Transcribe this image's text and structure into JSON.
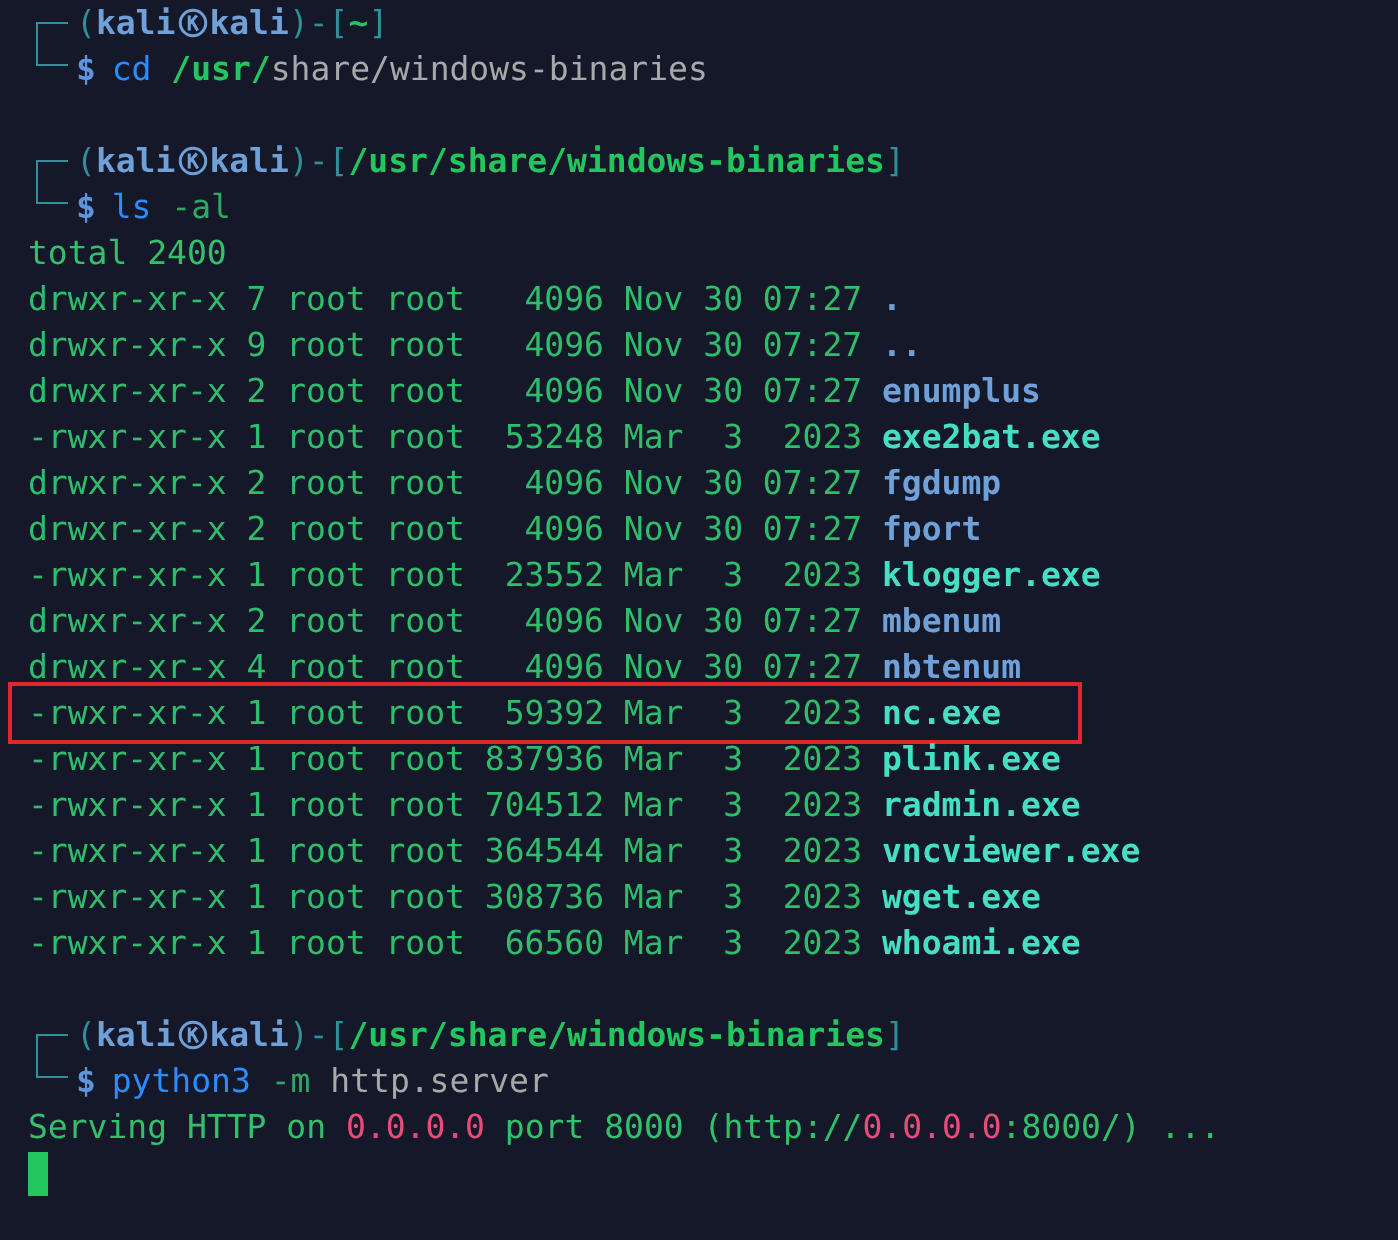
{
  "terminal": {
    "blocks": [
      {
        "kind": "prompt",
        "prompt": [
          {
            "kind": "frame",
            "text": "("
          },
          {
            "kind": "user",
            "text": "kali"
          },
          {
            "kind": "mark"
          },
          {
            "kind": "user",
            "text": "kali"
          },
          {
            "kind": "frame",
            "text": ")-["
          },
          {
            "kind": "path",
            "text": "~"
          },
          {
            "kind": "frame",
            "text": "]"
          }
        ],
        "command": [
          {
            "kind": "symbol",
            "text": "$"
          },
          {
            "kind": "program",
            "text": "cd"
          },
          {
            "kind": "path",
            "text": "/usr/"
          },
          {
            "kind": "argument",
            "text": "share/windows-binaries"
          }
        ]
      },
      {
        "kind": "blank"
      },
      {
        "kind": "prompt",
        "prompt": [
          {
            "kind": "frame",
            "text": "("
          },
          {
            "kind": "user",
            "text": "kali"
          },
          {
            "kind": "mark"
          },
          {
            "kind": "user",
            "text": "kali"
          },
          {
            "kind": "frame",
            "text": ")-["
          },
          {
            "kind": "path",
            "text": "/usr/share/windows-binaries"
          },
          {
            "kind": "frame",
            "text": "]"
          }
        ],
        "command": [
          {
            "kind": "symbol",
            "text": "$"
          },
          {
            "kind": "program",
            "text": "ls"
          },
          {
            "kind": "flag",
            "text": "-al"
          }
        ]
      },
      {
        "kind": "output",
        "segments": [
          {
            "kind": "plain",
            "text": "total 2400"
          }
        ]
      },
      {
        "kind": "entry",
        "mode": "drwxr-xr-x",
        "links": "7",
        "owner": "root",
        "group": "root",
        "size": "4096",
        "month": "Nov",
        "day": "30",
        "time": "07:27",
        "file": {
          "name": ".",
          "kind": "dir"
        },
        "highlighted": false
      },
      {
        "kind": "entry",
        "mode": "drwxr-xr-x",
        "links": "9",
        "owner": "root",
        "group": "root",
        "size": "4096",
        "month": "Nov",
        "day": "30",
        "time": "07:27",
        "file": {
          "name": "..",
          "kind": "dir"
        },
        "highlighted": false
      },
      {
        "kind": "entry",
        "mode": "drwxr-xr-x",
        "links": "2",
        "owner": "root",
        "group": "root",
        "size": "4096",
        "month": "Nov",
        "day": "30",
        "time": "07:27",
        "file": {
          "name": "enumplus",
          "kind": "dir"
        },
        "highlighted": false
      },
      {
        "kind": "entry",
        "mode": "-rwxr-xr-x",
        "links": "1",
        "owner": "root",
        "group": "root",
        "size": "53248",
        "month": "Mar",
        "day": "3",
        "time": "2023",
        "file": {
          "name": "exe2bat.exe",
          "kind": "exe"
        },
        "highlighted": false
      },
      {
        "kind": "entry",
        "mode": "drwxr-xr-x",
        "links": "2",
        "owner": "root",
        "group": "root",
        "size": "4096",
        "month": "Nov",
        "day": "30",
        "time": "07:27",
        "file": {
          "name": "fgdump",
          "kind": "dir"
        },
        "highlighted": false
      },
      {
        "kind": "entry",
        "mode": "drwxr-xr-x",
        "links": "2",
        "owner": "root",
        "group": "root",
        "size": "4096",
        "month": "Nov",
        "day": "30",
        "time": "07:27",
        "file": {
          "name": "fport",
          "kind": "dir"
        },
        "highlighted": false
      },
      {
        "kind": "entry",
        "mode": "-rwxr-xr-x",
        "links": "1",
        "owner": "root",
        "group": "root",
        "size": "23552",
        "month": "Mar",
        "day": "3",
        "time": "2023",
        "file": {
          "name": "klogger.exe",
          "kind": "exe"
        },
        "highlighted": false
      },
      {
        "kind": "entry",
        "mode": "drwxr-xr-x",
        "links": "2",
        "owner": "root",
        "group": "root",
        "size": "4096",
        "month": "Nov",
        "day": "30",
        "time": "07:27",
        "file": {
          "name": "mbenum",
          "kind": "dir"
        },
        "highlighted": false
      },
      {
        "kind": "entry",
        "mode": "drwxr-xr-x",
        "links": "4",
        "owner": "root",
        "group": "root",
        "size": "4096",
        "month": "Nov",
        "day": "30",
        "time": "07:27",
        "file": {
          "name": "nbtenum",
          "kind": "dir"
        },
        "highlighted": false
      },
      {
        "kind": "entry",
        "mode": "-rwxr-xr-x",
        "links": "1",
        "owner": "root",
        "group": "root",
        "size": "59392",
        "month": "Mar",
        "day": "3",
        "time": "2023",
        "file": {
          "name": "nc.exe",
          "kind": "exe"
        },
        "highlighted": true
      },
      {
        "kind": "entry",
        "mode": "-rwxr-xr-x",
        "links": "1",
        "owner": "root",
        "group": "root",
        "size": "837936",
        "month": "Mar",
        "day": "3",
        "time": "2023",
        "file": {
          "name": "plink.exe",
          "kind": "exe"
        },
        "highlighted": false
      },
      {
        "kind": "entry",
        "mode": "-rwxr-xr-x",
        "links": "1",
        "owner": "root",
        "group": "root",
        "size": "704512",
        "month": "Mar",
        "day": "3",
        "time": "2023",
        "file": {
          "name": "radmin.exe",
          "kind": "exe"
        },
        "highlighted": false
      },
      {
        "kind": "entry",
        "mode": "-rwxr-xr-x",
        "links": "1",
        "owner": "root",
        "group": "root",
        "size": "364544",
        "month": "Mar",
        "day": "3",
        "time": "2023",
        "file": {
          "name": "vncviewer.exe",
          "kind": "exe"
        },
        "highlighted": false
      },
      {
        "kind": "entry",
        "mode": "-rwxr-xr-x",
        "links": "1",
        "owner": "root",
        "group": "root",
        "size": "308736",
        "month": "Mar",
        "day": "3",
        "time": "2023",
        "file": {
          "name": "wget.exe",
          "kind": "exe"
        },
        "highlighted": false
      },
      {
        "kind": "entry",
        "mode": "-rwxr-xr-x",
        "links": "1",
        "owner": "root",
        "group": "root",
        "size": "66560",
        "month": "Mar",
        "day": "3",
        "time": "2023",
        "file": {
          "name": "whoami.exe",
          "kind": "exe"
        },
        "highlighted": false
      },
      {
        "kind": "blank"
      },
      {
        "kind": "prompt",
        "prompt": [
          {
            "kind": "frame",
            "text": "("
          },
          {
            "kind": "user",
            "text": "kali"
          },
          {
            "kind": "mark"
          },
          {
            "kind": "user",
            "text": "kali"
          },
          {
            "kind": "frame",
            "text": ")-["
          },
          {
            "kind": "path",
            "text": "/usr/share/windows-binaries"
          },
          {
            "kind": "frame",
            "text": "]"
          }
        ],
        "command": [
          {
            "kind": "symbol",
            "text": "$"
          },
          {
            "kind": "program",
            "text": "python3"
          },
          {
            "kind": "flag",
            "text": "-m"
          },
          {
            "kind": "argument",
            "text": "http.server"
          }
        ]
      },
      {
        "kind": "output",
        "segments": [
          {
            "kind": "plain",
            "text": "Serving HTTP on "
          },
          {
            "kind": "address",
            "text": "0.0.0.0"
          },
          {
            "kind": "plain",
            "text": " port 8000 (http://"
          },
          {
            "kind": "address",
            "text": "0.0.0.0"
          },
          {
            "kind": "plain",
            "text": ":8000/) ..."
          }
        ]
      },
      {
        "kind": "cursor"
      }
    ]
  }
}
